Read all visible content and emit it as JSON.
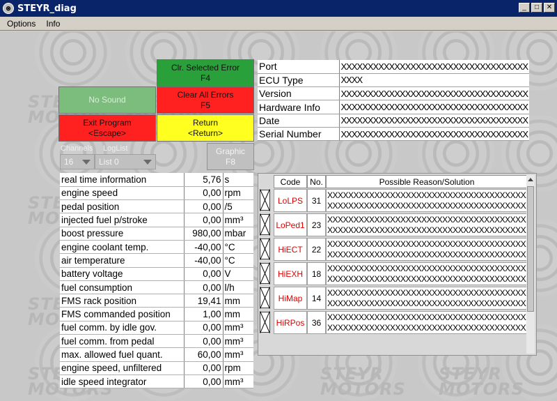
{
  "window": {
    "title": "STEYR_diag",
    "app_icon": "steyr-logo-icon"
  },
  "menu": [
    "Options",
    "Info"
  ],
  "watermark": "STEYR MOTORS",
  "buttons": {
    "clr_selected": [
      "Clr. Selected Error",
      "F4"
    ],
    "no_sound": "No Sound",
    "clr_all": [
      "Clear All Errors",
      "F5"
    ],
    "exit": [
      "Exit Program",
      "<Escape>"
    ],
    "return": [
      "Return",
      "<Return>"
    ],
    "graphic": [
      "Graphic",
      "F8"
    ]
  },
  "channels": {
    "label": "Channels",
    "value": "16"
  },
  "loglist": {
    "label": "LogList",
    "value": "List 0"
  },
  "info": [
    {
      "key": "Port",
      "value": "XXXXXXXXXXXXXXXXXXXXXXXXXXXXXXXXXXX"
    },
    {
      "key": "ECU Type",
      "value": "XXXX"
    },
    {
      "key": "Version",
      "value": "XXXXXXXXXXXXXXXXXXXXXXXXXXXXXXXXXXX"
    },
    {
      "key": "Hardware Info",
      "value": "XXXXXXXXXXXXXXXXXXXXXXXXXXXXXXXXXXX"
    },
    {
      "key": "Date",
      "value": "XXXXXXXXXXXXXXXXXXXXXXXXXXXXXXXXXXX"
    },
    {
      "key": "Serial Number",
      "value": "XXXXXXXXXXXXXXXXXXXXXXXXXXXXXXXXXXX"
    }
  ],
  "live": [
    {
      "name": "real time information",
      "value": "5,76",
      "unit": "s"
    },
    {
      "name": "engine speed",
      "value": "0,00",
      "unit": "rpm"
    },
    {
      "name": "pedal position",
      "value": "0,00",
      "unit": "/5"
    },
    {
      "name": "injected fuel p/stroke",
      "value": "0,00",
      "unit": "mm³"
    },
    {
      "name": "boost pressure",
      "value": "980,00",
      "unit": "mbar"
    },
    {
      "name": "engine coolant temp.",
      "value": "-40,00",
      "unit": "°C"
    },
    {
      "name": "air temperature",
      "value": "-40,00",
      "unit": "°C"
    },
    {
      "name": "battery voltage",
      "value": "0,00",
      "unit": "V"
    },
    {
      "name": "fuel consumption",
      "value": "0,00",
      "unit": "l/h"
    },
    {
      "name": "FMS rack position",
      "value": "19,41",
      "unit": "mm"
    },
    {
      "name": "FMS commanded position",
      "value": "1,00",
      "unit": "mm"
    },
    {
      "name": "fuel comm. by idle gov.",
      "value": "0,00",
      "unit": "mm³"
    },
    {
      "name": "fuel comm. from pedal",
      "value": "0,00",
      "unit": "mm³"
    },
    {
      "name": "max. allowed fuel quant.",
      "value": "60,00",
      "unit": "mm³"
    },
    {
      "name": "engine speed, unfiltered",
      "value": "0,00",
      "unit": "rpm"
    },
    {
      "name": "idle speed integrator",
      "value": "0,00",
      "unit": "mm³"
    }
  ],
  "errors_header": {
    "code": "Code",
    "no": "No.",
    "reason": "Possible Reason/Solution"
  },
  "errors": [
    {
      "code": "LoLPS",
      "no": "31",
      "line1": "XXXXXXXXXXXXXXXXXXXXXXXXXXXXXXXXXXXXXXXX",
      "line2": "XXXXXXXXXXXXXXXXXXXXXXXXXXXXXXXXXXXXXXXX"
    },
    {
      "code": "LoPed1",
      "no": "23",
      "line1": "XXXXXXXXXXXXXXXXXXXXXXXXXXXXXXXXXXXXXXXX",
      "line2": "XXXXXXXXXXXXXXXXXXXXXXXXXXXXXXXXXXXXXXXX"
    },
    {
      "code": "HiECT",
      "no": "22",
      "line1": "XXXXXXXXXXXXXXXXXXXXXXXXXXXXXXXXXXXXXXXX",
      "line2": "XXXXXXXXXXXXXXXXXXXXXXXXXXXXXXXXXXXXXXXX"
    },
    {
      "code": "HiEXH",
      "no": "18",
      "line1": "XXXXXXXXXXXXXXXXXXXXXXXXXXXXXXXXXXXXXXXX",
      "line2": "XXXXXXXXXXXXXXXXXXXXXXXXXXXXXXXXXXXXXXXX"
    },
    {
      "code": "HiMap",
      "no": "14",
      "line1": "XXXXXXXXXXXXXXXXXXXXXXXXXXXXXXXXXXXXXXXX",
      "line2": "XXXXXXXXXXXXXXXXXXXXXXXXXXXXXXXXXXXXXXXX"
    },
    {
      "code": "HiRPos",
      "no": "36",
      "line1": "XXXXXXXXXXXXXXXXXXXXXXXXXXXXXXXXXXXXXXXX",
      "line2": "XXXXXXXXXXXXXXXXXXXXXXXXXXXXXXXXXXXXXXXX"
    }
  ],
  "colors": {
    "title_bar": "#0a246a",
    "green": "#2aa03a",
    "red": "#ff2020",
    "yellow": "#ffff20",
    "error_code": "#e00000"
  }
}
